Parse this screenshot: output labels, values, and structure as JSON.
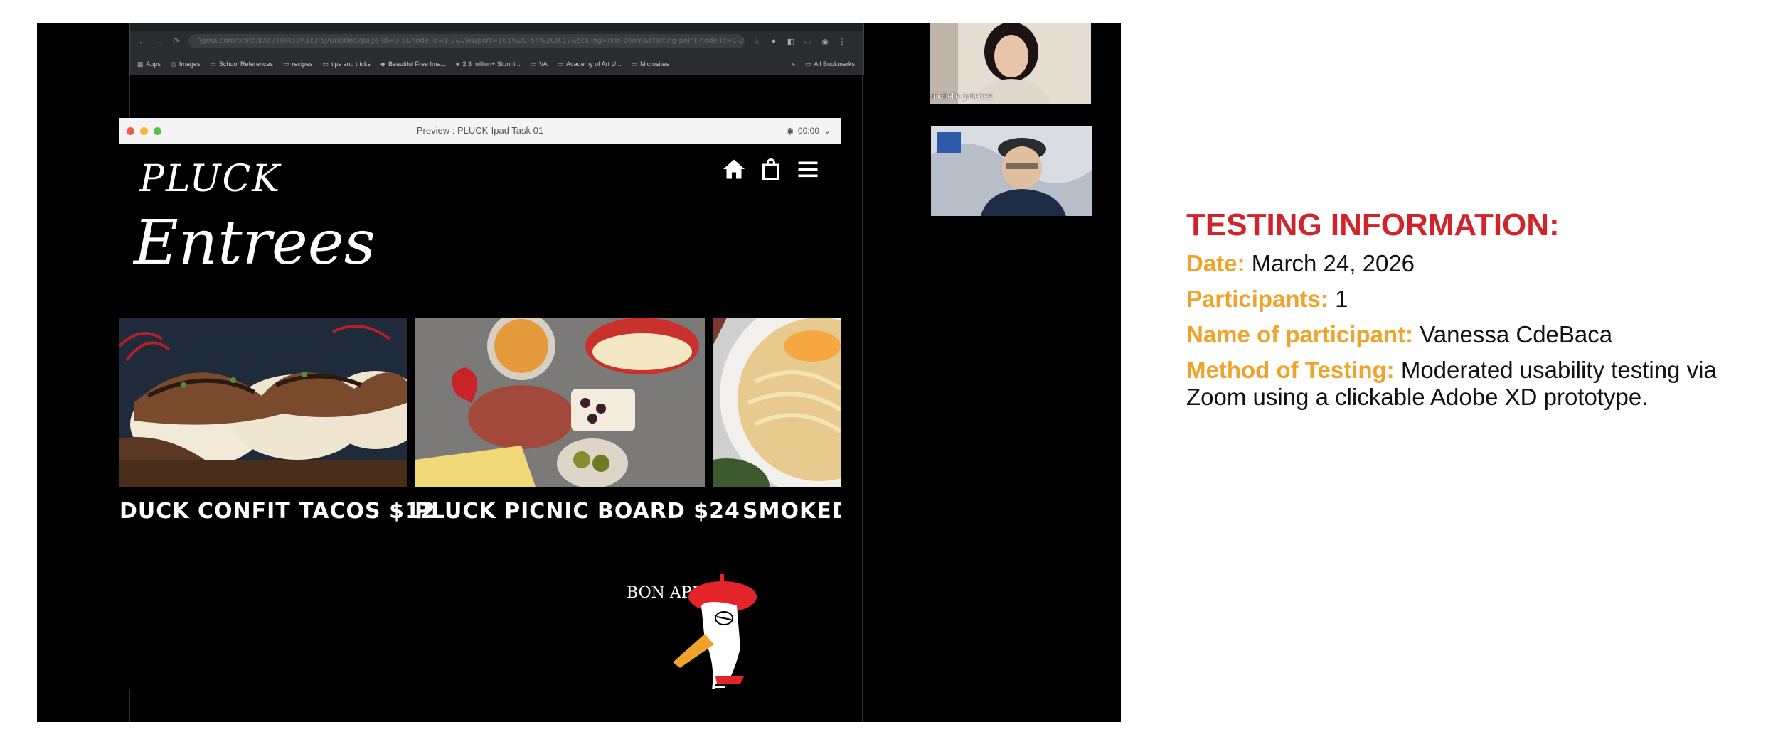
{
  "browser": {
    "url": "figma.com/proto/kXc7TMR5BK1c3l5J/Untitled?page-id=0-1&node-id=1-2&viewport=161%2C-54%2C0.17&scaling=min-zoom&starting-point-node-id=1-2",
    "bookmarks": [
      "Apps",
      "Images",
      "School References",
      "recipes",
      "tips and tricks",
      "Beautiful Free Ima...",
      "2.3 million+ Stunni...",
      "VA",
      "Academy of Art U...",
      "Microsites"
    ],
    "all_bookmarks": "All Bookmarks"
  },
  "preview": {
    "title": "Preview : PLUCK-Ipad Task 01",
    "timer": "00:00"
  },
  "app": {
    "logo": "PLUCK",
    "section_title": "Entrees",
    "items": [
      {
        "label": "DUCK CONFIT TACOS $12"
      },
      {
        "label": "PLUCK PICNIC BOARD $24"
      },
      {
        "label": "SMOKED DU"
      }
    ],
    "bon_appetit": "BON APPÉTIT!"
  },
  "participants": [
    {
      "name": "michelle gutierrez"
    },
    {
      "name": ""
    }
  ],
  "info": {
    "title": "TESTING INFORMATION:",
    "date_label": "Date:",
    "date_value": "March 24, 2026",
    "participants_label": "Participants:",
    "participants_value": "1",
    "name_label": "Name of participant:",
    "name_value": "Vanessa CdeBaca",
    "method_label": "Method of Testing:",
    "method_value": "Moderated usability testing via Zoom using a clickable Adobe XD prototype."
  },
  "colors": {
    "title_red": "#d1232a",
    "label_orange": "#f0a32b"
  }
}
